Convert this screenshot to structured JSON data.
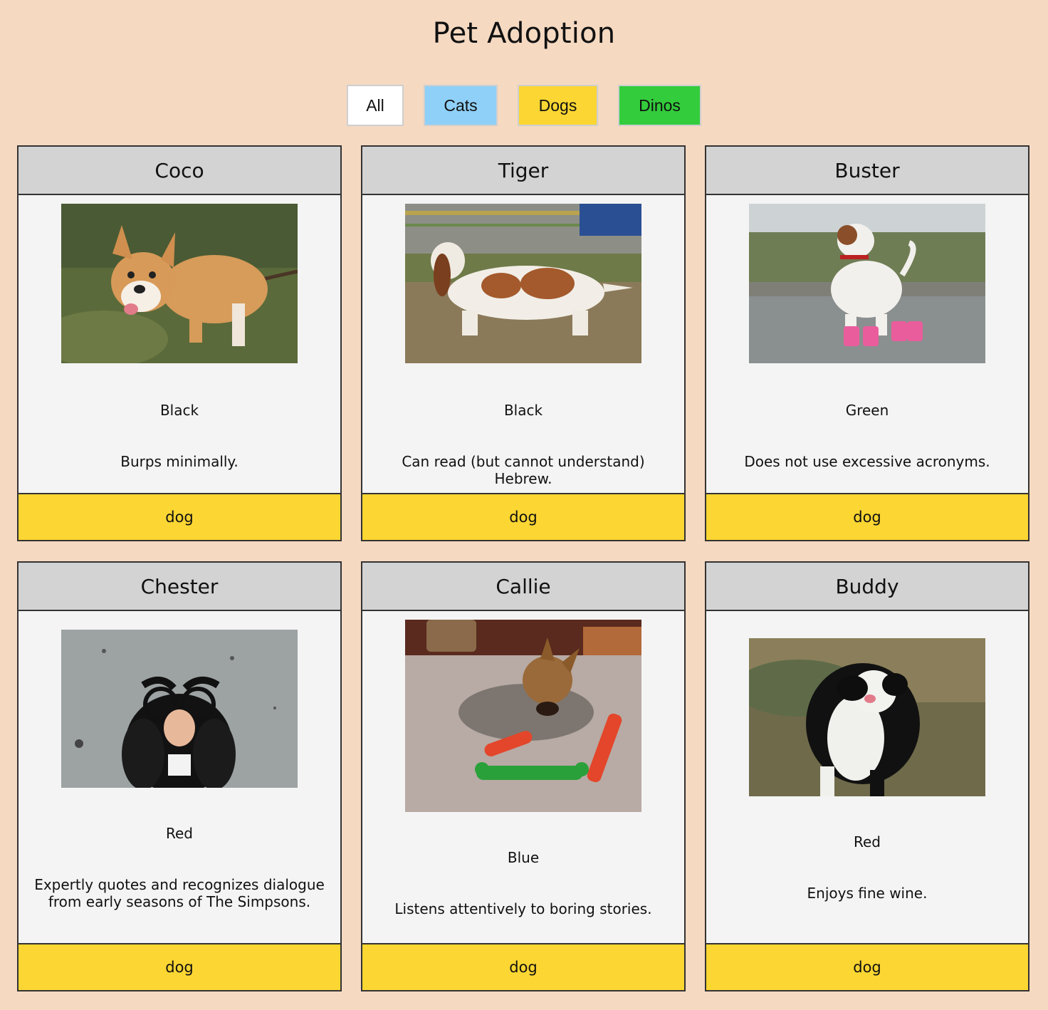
{
  "page": {
    "title": "Pet Adoption"
  },
  "filters": [
    {
      "label": "All",
      "color": "#ffffff"
    },
    {
      "label": "Cats",
      "color": "#8fd0f8"
    },
    {
      "label": "Dogs",
      "color": "#fcd632"
    },
    {
      "label": "Dinos",
      "color": "#33cc3c"
    }
  ],
  "pets": [
    {
      "name": "Coco",
      "color": "Black",
      "description": "Burps minimally.",
      "type": "dog",
      "photo": "corgi-with-stick"
    },
    {
      "name": "Tiger",
      "color": "Black",
      "description": "Can read (but cannot understand) Hebrew.",
      "type": "dog",
      "photo": "basset-hound-on-grass"
    },
    {
      "name": "Buster",
      "color": "Green",
      "description": "Does not use excessive acronyms.",
      "type": "dog",
      "photo": "terrier-in-pink-boots"
    },
    {
      "name": "Chester",
      "color": "Red",
      "description": "Expertly quotes and recognizes dialogue from early seasons of The Simpsons.",
      "type": "dog",
      "photo": "spaniel-with-disguise-glasses"
    },
    {
      "name": "Callie",
      "color": "Blue",
      "description": "Listens attentively to boring stories.",
      "type": "dog",
      "photo": "yorkie-with-chew-toy"
    },
    {
      "name": "Buddy",
      "color": "Red",
      "description": "Enjoys fine wine.",
      "type": "dog",
      "photo": "wet-dog-shaking"
    }
  ],
  "colors": {
    "page_bg": "#f5d9c1",
    "card_header": "#d3d3d3",
    "card_footer_dog": "#fcd632"
  }
}
